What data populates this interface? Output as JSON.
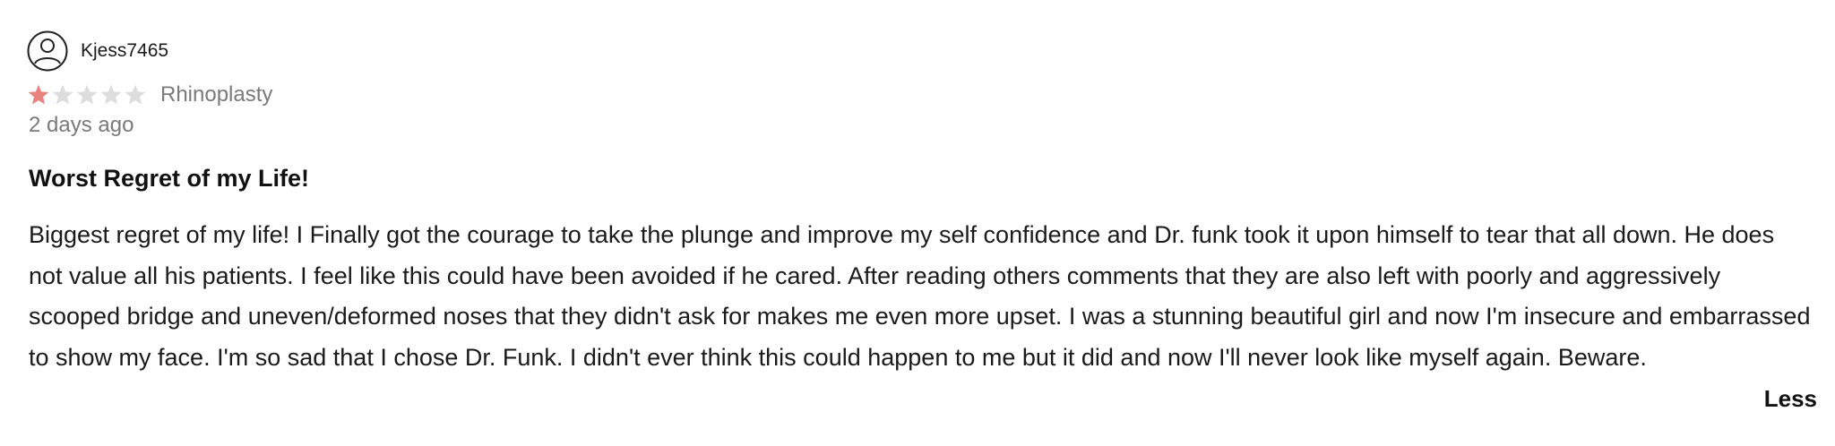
{
  "review": {
    "username": "Kjess7465",
    "rating": 1,
    "max_rating": 5,
    "procedure": "Rhinoplasty",
    "date": "2 days ago",
    "title": "Worst Regret of my Life!",
    "body": "Biggest regret of my life! I Finally got the courage to take the plunge and improve my self confidence and Dr. funk took it upon himself to tear that all down. He does not value all his patients. I feel like this could have been avoided if he cared. After reading others comments that they are also left with poorly and aggressively scooped bridge and uneven/deformed noses that they didn't ask for makes me even more upset. I was a stunning beautiful girl and now I'm insecure and embarrassed to show my face. I'm so sad that I chose Dr. Funk. I didn't ever think this could happen to me but it did and now I'll never look like myself again. Beware.",
    "less_label": "Less"
  },
  "icons": {
    "avatar": "user-circle-icon",
    "star": "star-icon"
  },
  "colors": {
    "star_filled": "#e8837f",
    "star_empty": "#dddddd",
    "muted_text": "#7a7a7a"
  }
}
